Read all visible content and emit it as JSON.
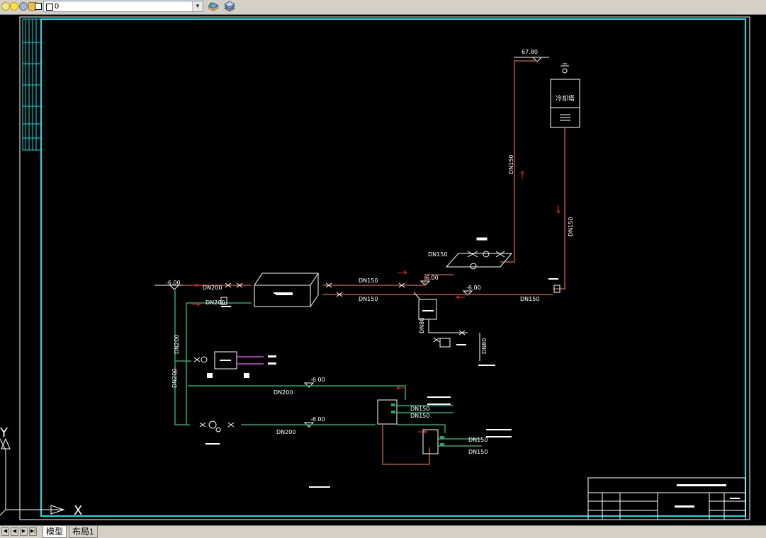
{
  "toolbar": {
    "layer_value": "0",
    "combo_arrow": "▼",
    "icons": [
      "bulb-icon",
      "sun-icon",
      "gear-icon",
      "lock-icon",
      "color-swatch-icon",
      "layer-previous-icon",
      "layer-manager-icon"
    ]
  },
  "drawing": {
    "elevations": {
      "cooling_tower_top": "67.80",
      "inlet_left": "-6.00",
      "pipe_right": "-6.00",
      "mid_right": "-6.00",
      "supply_mid": "-6.00",
      "return_mid": "-6.00"
    },
    "pipe_labels": {
      "dn200_top": "DN200",
      "dn200_second": "DN200",
      "dn200_vertical_a": "DN200",
      "dn200_vertical_b": "DN200",
      "dn200_supply": "DN200",
      "dn200_return": "DN200",
      "dn150_pump_group": "DN150",
      "dn150_main_upper": "DN150",
      "dn150_main_lower": "DN150",
      "dn150_right_bottom": "DN150",
      "dn150_riser_left": "DN150",
      "dn150_riser_right": "DN150",
      "dn150_manifold_a": "DN150",
      "dn150_manifold_b": "DN150",
      "dn150_manifold_c": "DN150",
      "dn150_manifold_d": "DN150",
      "dn80_vertical": "DN80",
      "dn80_drain": "DN80"
    },
    "cooling_tower_label": "冷却塔"
  },
  "colors": {
    "frame": "#00e5e5",
    "supply_pipe": "#1fa874",
    "return_pipe": "#b5553c",
    "flow_arrow": "#e02020",
    "pipe_text": "#ffffff",
    "ucs": "#ffffff"
  },
  "ucs": {
    "x_label": "X",
    "y_label": "Y"
  },
  "tabs": {
    "nav": [
      "◀",
      "◀",
      "▶",
      "▶|"
    ],
    "model": "模型",
    "layout1": "布局1"
  }
}
